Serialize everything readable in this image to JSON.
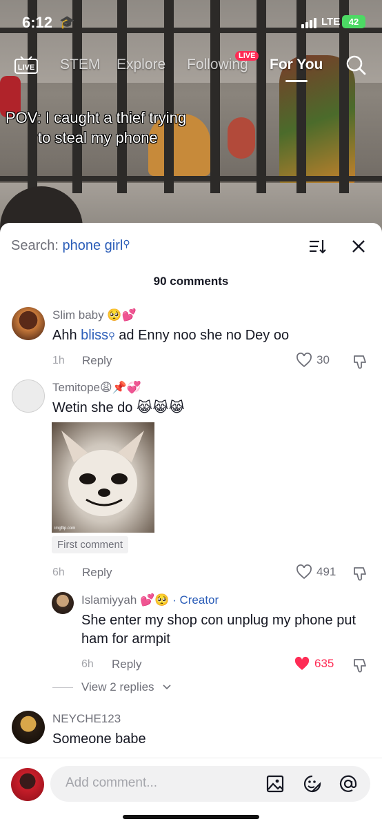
{
  "status": {
    "time": "6:12",
    "network": "LTE",
    "battery": "42"
  },
  "tabs": {
    "live": "LIVE",
    "items": [
      "STEM",
      "Explore",
      "Following",
      "For You"
    ],
    "following_badge": "LIVE"
  },
  "caption": {
    "line1": "POV: I caught a thief trying",
    "line2": "to steal my phone"
  },
  "sheet": {
    "search_label": "Search:",
    "search_query": "phone girl",
    "count": "90 comments"
  },
  "comments": [
    {
      "user": "Slim baby 🥺💕",
      "text_before": "Ahh ",
      "highlight": "bliss",
      "text_after": " ad Enny noo she no Dey oo",
      "time": "1h",
      "reply": "Reply",
      "likes": "30"
    },
    {
      "user": "Temitope😩📌💞",
      "text": "Wetin she do 😹😹😹",
      "image_caption": "imgflip.com",
      "tag": "First comment",
      "time": "6h",
      "reply": "Reply",
      "likes": "491"
    },
    {
      "user": "Islamiyyah 💕🥺",
      "creator": "· Creator",
      "text": "She enter my shop con unplug my phone put ham for armpit",
      "time": "6h",
      "reply": "Reply",
      "likes": "635"
    },
    {
      "user": "NEYCHE123",
      "text": "Someone babe"
    }
  ],
  "view_replies": "View 2 replies",
  "input": {
    "placeholder": "Add comment..."
  },
  "colors": {
    "accent_red": "#fe2c55",
    "link_blue": "#2b5db8",
    "battery_green": "#4cd964"
  }
}
